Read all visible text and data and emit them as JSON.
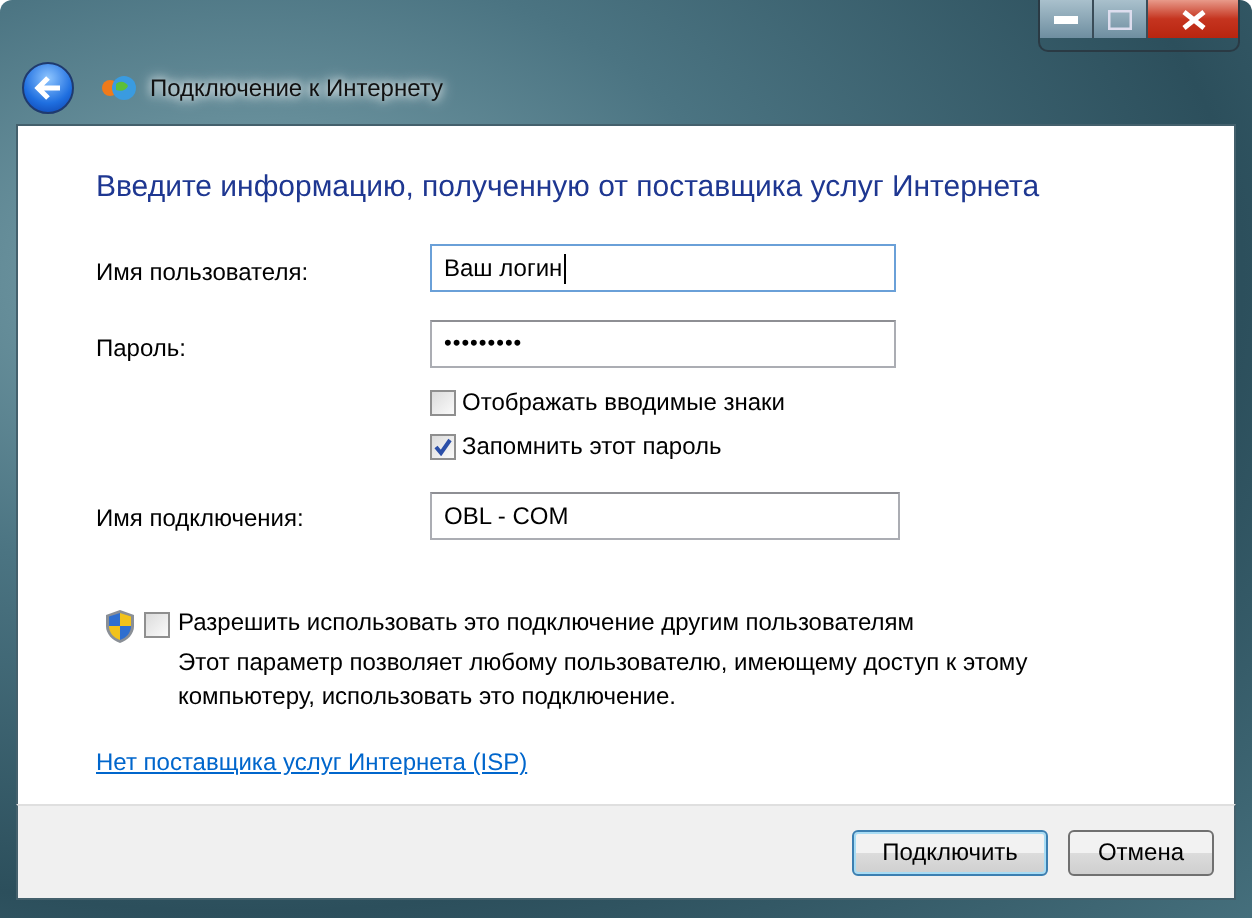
{
  "window": {
    "title": "Подключение к Интернету"
  },
  "heading": "Введите информацию, полученную от поставщика услуг Интернета",
  "fields": [
    {
      "label": "Имя пользователя:",
      "value": "Ваш логин",
      "focused": true
    },
    {
      "label": "Пароль:",
      "value": "•••••••••",
      "focused": false
    }
  ],
  "password_options": [
    {
      "label": "Отображать вводимые знаки",
      "checked": false
    },
    {
      "label": "Запомнить этот пароль",
      "checked": true
    }
  ],
  "connection_name": {
    "label": "Имя подключения:",
    "value": "OBL - COM"
  },
  "share": {
    "label": "Разрешить использовать это подключение другим пользователям",
    "checked": false,
    "description": "Этот параметр позволяет любому пользователю, имеющему доступ к этому компьютеру, использовать это подключение."
  },
  "isp_link": "Нет поставщика услуг Интернета (ISP)",
  "buttons": [
    {
      "label": "Подключить",
      "default": true
    },
    {
      "label": "Отмена",
      "default": false
    }
  ]
}
